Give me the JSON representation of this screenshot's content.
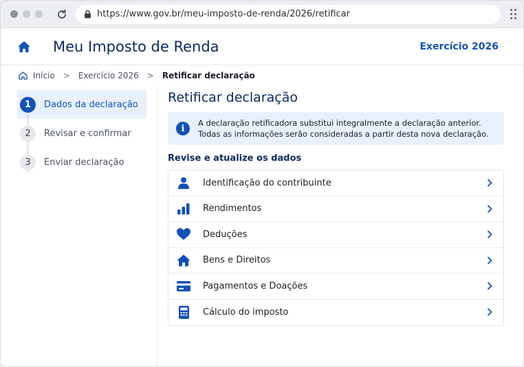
{
  "browser": {
    "url": "https://www.gov.br/meu-imposto-de-renda/2026/retificar"
  },
  "header": {
    "app_title": "Meu Imposto de Renda",
    "exercise": "Exercício 2026"
  },
  "breadcrumb": {
    "items": [
      "Início",
      "Exercício 2026",
      "Retificar declaração"
    ]
  },
  "steps": [
    {
      "number": "1",
      "label": "Dados da declaração",
      "active": true
    },
    {
      "number": "2",
      "label": "Revisar e confirmar",
      "active": false
    },
    {
      "number": "3",
      "label": "Enviar declaração",
      "active": false
    }
  ],
  "main": {
    "title": "Retificar declaração",
    "info_icon": "i",
    "info_line1": "A declaração retificadora substitui integralmente a declaração anterior.",
    "info_line2": "Todas as informações serão consideradas a partir desta nova declaração.",
    "section_title": "Revise e atualize os dados",
    "items": [
      {
        "label": "Identificação do contribuinte",
        "icon": "person-icon"
      },
      {
        "label": "Rendimentos",
        "icon": "bar-chart-icon"
      },
      {
        "label": "Deduções",
        "icon": "heart-icon"
      },
      {
        "label": "Bens e Direitos",
        "icon": "house-icon"
      },
      {
        "label": "Pagamentos e Doações",
        "icon": "credit-card-icon"
      },
      {
        "label": "Cálculo do imposto",
        "icon": "calculator-icon"
      }
    ]
  },
  "colors": {
    "primary": "#1351b4",
    "title": "#0c2a5c",
    "highlight": "#e8f0fb"
  }
}
